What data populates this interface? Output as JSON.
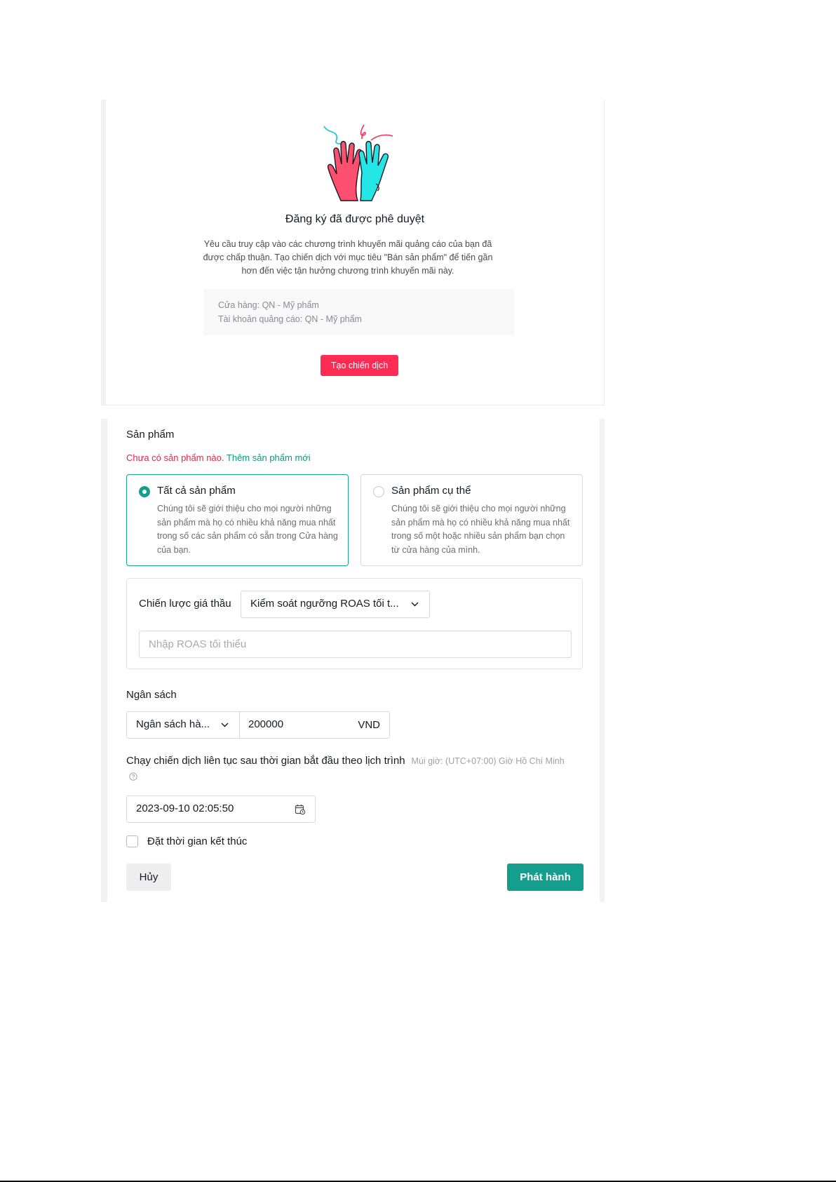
{
  "approval": {
    "title": "Đăng ký đã được phê duyệt",
    "description": "Yêu cầu truy cập vào các chương trình khuyến mãi quảng cáo của bạn đã được chấp thuận. Tạo chiến dịch với mục tiêu \"Bán sản phẩm\" để tiến gần hơn đến việc tận hưởng chương trình khuyến mãi này.",
    "store_line": "Cửa hàng: QN - Mỹ phẩm",
    "ad_account_line": "Tài khoản quảng cáo: QN - Mỹ phẩm",
    "create_button": "Tạo chiến dịch",
    "illustration_icon": "high-five-hands-icon",
    "colors": {
      "left_hand": "#fe4f6e",
      "right_hand": "#25e6e6",
      "accent": "#fe2c55"
    }
  },
  "form": {
    "products_label": "Sản phẩm",
    "no_products_text": "Chưa có sản phẩm nào.",
    "add_product_link": "Thêm sản phẩm mới",
    "options": [
      {
        "title": "Tất cả sản phẩm",
        "description": "Chúng tôi sẽ giới thiệu cho mọi người những sản phẩm mà họ có nhiều khả năng mua nhất trong số các sản phẩm có sẵn trong Cửa hàng của bạn.",
        "selected": true
      },
      {
        "title": "Sản phẩm cụ thể",
        "description": "Chúng tôi sẽ giới thiệu cho mọi người những sản phẩm mà họ có nhiều khả năng mua nhất trong số một hoặc nhiều sản phẩm bạn chọn từ cửa hàng của mình.",
        "selected": false
      }
    ],
    "bid_strategy_label": "Chiến lược giá thầu",
    "bid_strategy_value": "Kiểm soát ngưỡng ROAS tối t...",
    "roas_placeholder": "Nhập ROAS tối thiểu",
    "budget_label": "Ngân sách",
    "budget_type_value": "Ngân sách hà...",
    "budget_amount": "200000",
    "currency": "VND",
    "schedule_label": "Chạy chiến dịch liên tục sau thời gian bắt đầu theo lịch trình",
    "timezone_note": "Múi giờ: (UTC+07:00) Giờ Hồ Chí Minh",
    "start_datetime": "2023-09-10 02:05:50",
    "end_time_checkbox_label": "Đặt thời gian kết thúc",
    "end_time_checked": false,
    "cancel_button": "Hủy",
    "publish_button": "Phát hành",
    "colors": {
      "primary": "#149e8d",
      "error": "#e0284a",
      "link": "#12957d"
    }
  }
}
